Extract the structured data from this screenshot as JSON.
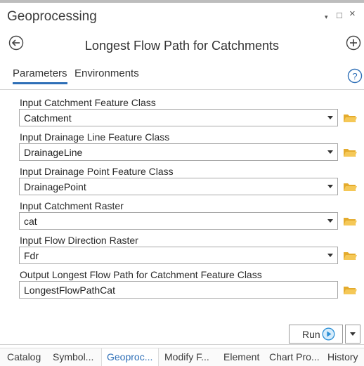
{
  "window": {
    "title": "Geoprocessing",
    "pin_glyph": "▾",
    "maximize_glyph": "□",
    "close_glyph": "×"
  },
  "tool": {
    "title": "Longest Flow Path for Catchments"
  },
  "tabs": [
    {
      "label": "Parameters",
      "active": true
    },
    {
      "label": "Environments",
      "active": false
    }
  ],
  "params": [
    {
      "label": "Input Catchment Feature Class",
      "value": "Catchment",
      "dropdown": true
    },
    {
      "label": "Input Drainage Line Feature Class",
      "value": "DrainageLine",
      "dropdown": true
    },
    {
      "label": "Input Drainage Point Feature Class",
      "value": "DrainagePoint",
      "dropdown": true
    },
    {
      "label": "Input Catchment Raster",
      "value": "cat",
      "dropdown": true
    },
    {
      "label": "Input Flow Direction Raster",
      "value": "Fdr",
      "dropdown": true
    },
    {
      "label": "Output Longest Flow Path for Catchment Feature Class",
      "value": "LongestFlowPathCat",
      "dropdown": false
    }
  ],
  "run": {
    "label": "Run"
  },
  "bottom_tabs": [
    {
      "label": "Catalog",
      "active": false
    },
    {
      "label": "Symbol...",
      "active": false
    },
    {
      "label": "Geoproc...",
      "active": true
    },
    {
      "label": "Modify F...",
      "active": false
    },
    {
      "label": "Element",
      "active": false
    },
    {
      "label": "Chart Pro...",
      "active": false
    },
    {
      "label": "History",
      "active": false
    }
  ],
  "colors": {
    "accent": "#2e6fb7",
    "folder": "#f0c04a",
    "run_icon": "#2b8fd6"
  },
  "icons": {
    "back": "back-arrow-circle-icon",
    "add": "add-circle-icon",
    "help": "help-circle-icon",
    "folder": "folder-open-icon",
    "run": "run-play-icon"
  }
}
